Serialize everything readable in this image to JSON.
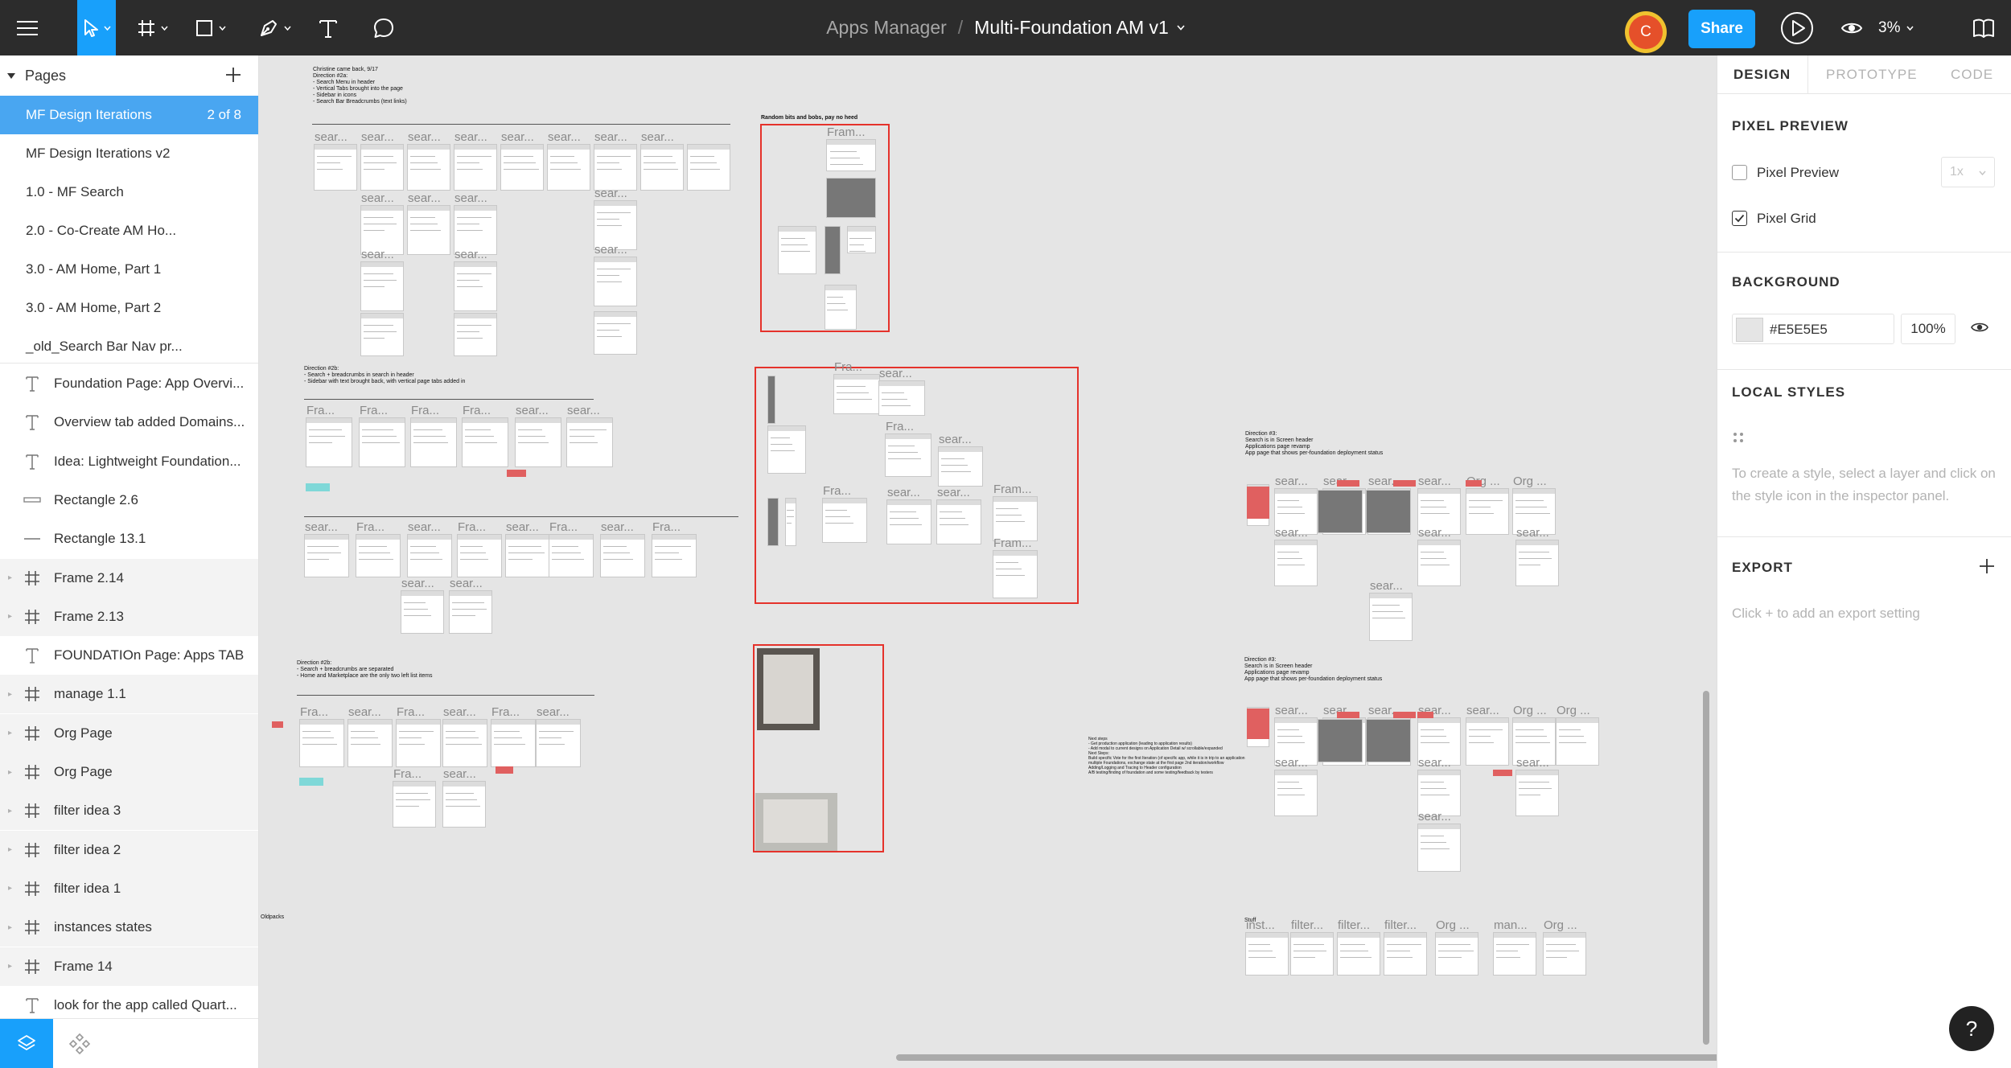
{
  "toolbar": {
    "project": "Apps Manager",
    "separator": "/",
    "file_name": "Multi-Foundation AM v1",
    "avatar_initial": "C",
    "share_label": "Share",
    "zoom_level": "3%",
    "accent_color": "#18a0fb"
  },
  "pages": {
    "header": "Pages",
    "items": [
      {
        "label": "MF Design Iterations",
        "count": "2 of 8"
      },
      {
        "label": "MF Design Iterations v2"
      },
      {
        "label": "1.0 - MF Search"
      },
      {
        "label": "2.0 - Co-Create AM Ho..."
      },
      {
        "label": "3.0 - AM Home, Part 1"
      },
      {
        "label": "3.0 - AM Home, Part 2"
      },
      {
        "label": "_old_Search Bar Nav pr..."
      }
    ]
  },
  "layers": [
    {
      "label": "Foundation Page: App Overvi...",
      "icon": "text-icon"
    },
    {
      "label": "Overview tab added Domains...",
      "icon": "text-icon"
    },
    {
      "label": "Idea: Lightweight Foundation...",
      "icon": "text-icon"
    },
    {
      "label": "Rectangle 2.6",
      "icon": "rectangle-icon"
    },
    {
      "label": "Rectangle 13.1",
      "icon": "line-icon"
    },
    {
      "label": "Frame 2.14",
      "icon": "frame-icon"
    },
    {
      "label": "Frame 2.13",
      "icon": "frame-icon"
    },
    {
      "label": "FOUNDATIOn Page: Apps TAB",
      "icon": "text-icon"
    },
    {
      "label": "manage 1.1",
      "icon": "frame-icon"
    },
    {
      "label": "Org Page",
      "icon": "frame-icon"
    },
    {
      "label": "Org Page",
      "icon": "frame-icon"
    },
    {
      "label": "filter idea 3",
      "icon": "frame-icon"
    },
    {
      "label": "filter idea 2",
      "icon": "frame-icon"
    },
    {
      "label": "filter idea 1",
      "icon": "frame-icon"
    },
    {
      "label": "instances states",
      "icon": "frame-icon"
    },
    {
      "label": "Frame 14",
      "icon": "frame-icon"
    },
    {
      "label": "look for the app called Quart...",
      "icon": "text-icon"
    }
  ],
  "canvas": {
    "background": "#E5E5E5",
    "notes": {
      "d2a": "Christine came back, 9/17\nDirection #2a:\n- Search Menu in header\n- Vertical Tabs brought into the page\n- Sidebar in icons\n- Search Bar Breadcrumbs (text links)",
      "random": "Random bits and bobs, pay no heed",
      "d2b": "Direction #2b:\n- Search + breadcrumbs in search in header\n- Sidebar with text brought back, with vertical page tabs added in",
      "d2c": "Direction #2b:\n- Search + breadcrumbs are separated\n- Home and Marketplace are the only two left list items",
      "d3a": "Direction #3:\nSearch is in Screen header\nApplications page revamp\nApp page that shows per-foundation deployment status",
      "d3b": "Direction #3:\nSearch is in Screen header\nApplications page revamp\nApp page that shows per-foundation deployment status",
      "stuff": "Stuff",
      "oldpacks": "Oldpacks",
      "small_list": "Next steps\n- Get production application (leading to application results)\n- Add modal to current designs on Application Detail w/ scrollable/expanded\nNext Steps:\nBuild specific Vote for the first Iteration (of specific app, while it is in trip to an application\nmultiple Foundations, exchange state at the first page 2nd iteration/workflow\nAdding/Logging and Tracing to Header configuration\nA/B testing/finding of foundation and some testing/feedback by testers"
    },
    "labels": {
      "sear": "sear...",
      "fra": "Fra...",
      "fram": "Fram...",
      "org": "Org ...",
      "inst": "inst...",
      "filter": "filter...",
      "man": "man...",
      "dots": "..."
    }
  },
  "inspector": {
    "tabs": [
      "DESIGN",
      "PROTOTYPE",
      "CODE"
    ],
    "pixel_preview": {
      "title": "PIXEL PREVIEW",
      "preview_label": "Pixel Preview",
      "preview_checked": false,
      "scale": "1x",
      "grid_label": "Pixel Grid",
      "grid_checked": true
    },
    "background": {
      "title": "BACKGROUND",
      "hex": "#E5E5E5",
      "opacity": "100%"
    },
    "local_styles": {
      "title": "LOCAL STYLES",
      "help": "To create a style, select a layer and click on the style icon in the inspector panel."
    },
    "export": {
      "title": "EXPORT",
      "help": "Click + to add an export setting"
    }
  },
  "help_label": "?"
}
